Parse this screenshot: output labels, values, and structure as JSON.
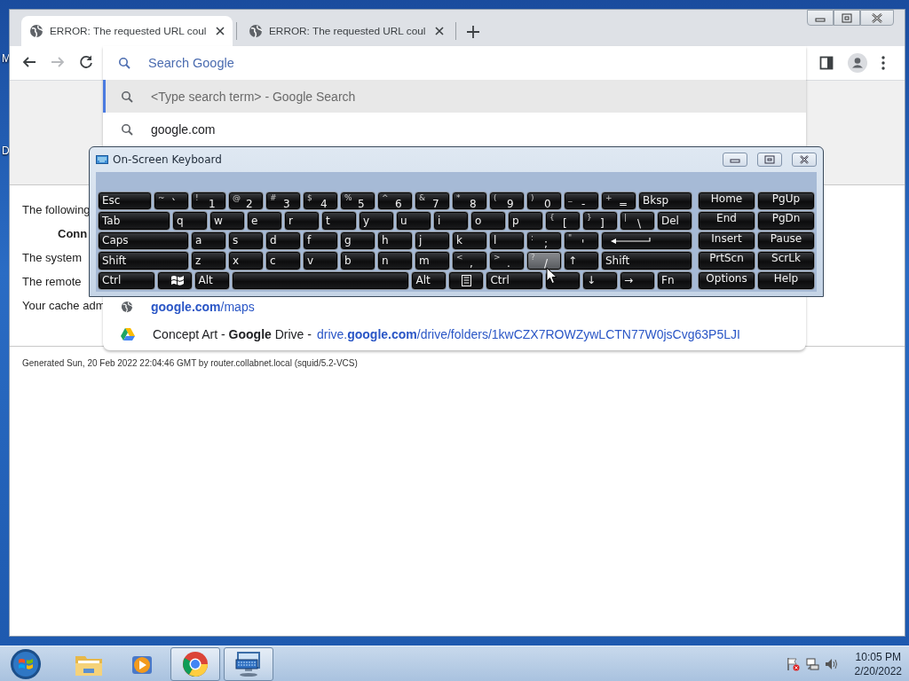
{
  "desktop": {
    "icon_labels": [
      "M",
      "D"
    ]
  },
  "browser": {
    "tabs": [
      {
        "title": "ERROR: The requested URL coul",
        "selected": true
      },
      {
        "title": "ERROR: The requested URL coul",
        "selected": false
      }
    ],
    "nav_buttons": [
      {
        "kind": "back",
        "disabled": false
      },
      {
        "kind": "forward",
        "disabled": true
      },
      {
        "kind": "reload",
        "disabled": false
      }
    ],
    "omnibox": {
      "placeholder": "Search Google",
      "suggestions": [
        {
          "kind": "search",
          "text": "<Type search term> - Google Search",
          "selected": true
        },
        {
          "kind": "search",
          "text": "google.com",
          "selected": false
        },
        {
          "kind": "history",
          "url": "**google.com**/maps",
          "selected": false
        },
        {
          "kind": "drive",
          "text": "Concept Art - **Google** Drive -",
          "url": "drive.**google.com**/drive/folders/1kwCZX7ROWZywLCTN77W0jsCvg63P5LJI",
          "selected": false
        }
      ]
    },
    "page": {
      "paragraphs": [
        {
          "kind": "plain",
          "text": "The following"
        },
        {
          "kind": "bold",
          "text": "Conn"
        },
        {
          "kind": "plain",
          "text": "The system"
        },
        {
          "kind": "plain",
          "text": "The remote"
        },
        {
          "kind": "plain",
          "text": "Your cache adm"
        }
      ],
      "footer": "Generated Sun, 20 Feb 2022 22:04:46 GMT by router.collabnet.local (squid/5.2-VCS)"
    }
  },
  "keyboard": {
    "title": "On-Screen Keyboard",
    "key_rows": [
      {
        "keys": [
          {
            "kind": "wide",
            "label": "Esc",
            "hover": false
          },
          {
            "kind": "key",
            "shift": "~",
            "label": "`",
            "hover": false
          },
          {
            "kind": "key",
            "shift": "!",
            "label": "1",
            "hover": false
          },
          {
            "kind": "key",
            "shift": "@",
            "label": "2",
            "hover": false
          },
          {
            "kind": "key",
            "shift": "#",
            "label": "3",
            "hover": false
          },
          {
            "kind": "key",
            "shift": "$",
            "label": "4",
            "hover": false
          },
          {
            "kind": "key",
            "shift": "%",
            "label": "5",
            "hover": false
          },
          {
            "kind": "key",
            "shift": "^",
            "label": "6",
            "hover": false
          },
          {
            "kind": "key",
            "shift": "&",
            "label": "7",
            "hover": false
          },
          {
            "kind": "key",
            "shift": "*",
            "label": "8",
            "hover": false
          },
          {
            "kind": "key",
            "shift": "(",
            "label": "9",
            "hover": false
          },
          {
            "kind": "key",
            "shift": ")",
            "label": "0",
            "hover": false
          },
          {
            "kind": "key",
            "shift": "_",
            "label": "-",
            "hover": false
          },
          {
            "kind": "key",
            "shift": "+",
            "label": "=",
            "hover": false
          },
          {
            "kind": "wide",
            "label": "Bksp",
            "hover": false
          }
        ]
      },
      {
        "keys": [
          {
            "kind": "wide",
            "label": "Tab",
            "hover": false
          },
          {
            "kind": "key",
            "label": "q",
            "hover": false
          },
          {
            "kind": "key",
            "label": "w",
            "hover": false
          },
          {
            "kind": "key",
            "label": "e",
            "hover": false
          },
          {
            "kind": "key",
            "label": "r",
            "hover": false
          },
          {
            "kind": "key",
            "label": "t",
            "hover": false
          },
          {
            "kind": "key",
            "label": "y",
            "hover": false
          },
          {
            "kind": "key",
            "label": "u",
            "hover": false
          },
          {
            "kind": "key",
            "label": "i",
            "hover": false
          },
          {
            "kind": "key",
            "label": "o",
            "hover": false
          },
          {
            "kind": "key",
            "label": "p",
            "hover": false
          },
          {
            "kind": "key",
            "shift": "{",
            "label": "[",
            "hover": false
          },
          {
            "kind": "key",
            "shift": "}",
            "label": "]",
            "hover": false
          },
          {
            "kind": "key",
            "shift": "|",
            "label": "\\",
            "hover": false
          },
          {
            "kind": "key",
            "label": "Del",
            "hover": false
          }
        ]
      },
      {
        "keys": [
          {
            "kind": "wide",
            "label": "Caps",
            "hover": false
          },
          {
            "kind": "key",
            "label": "a",
            "hover": false
          },
          {
            "kind": "key",
            "label": "s",
            "hover": false
          },
          {
            "kind": "key",
            "label": "d",
            "hover": false
          },
          {
            "kind": "key",
            "label": "f",
            "hover": false
          },
          {
            "kind": "key",
            "label": "g",
            "hover": false
          },
          {
            "kind": "key",
            "label": "h",
            "hover": false
          },
          {
            "kind": "key",
            "label": "j",
            "hover": false
          },
          {
            "kind": "key",
            "label": "k",
            "hover": false
          },
          {
            "kind": "key",
            "label": "l",
            "hover": false
          },
          {
            "kind": "key",
            "shift": ":",
            "label": ";",
            "hover": false
          },
          {
            "kind": "key",
            "shift": "\"",
            "label": "'",
            "hover": false
          },
          {
            "kind": "enter",
            "hover": false
          }
        ]
      },
      {
        "keys": [
          {
            "kind": "wide",
            "label": "Shift",
            "hover": false
          },
          {
            "kind": "key",
            "label": "z",
            "hover": false
          },
          {
            "kind": "key",
            "label": "x",
            "hover": false
          },
          {
            "kind": "key",
            "label": "c",
            "hover": false
          },
          {
            "kind": "key",
            "label": "v",
            "hover": false
          },
          {
            "kind": "key",
            "label": "b",
            "hover": false
          },
          {
            "kind": "key",
            "label": "n",
            "hover": false
          },
          {
            "kind": "key",
            "label": "m",
            "hover": false
          },
          {
            "kind": "key",
            "shift": "<",
            "label": ",",
            "hover": false
          },
          {
            "kind": "key",
            "shift": ">",
            "label": ".",
            "hover": false
          },
          {
            "kind": "key",
            "shift": "?",
            "label": "/",
            "hover": true
          },
          {
            "kind": "key",
            "label": "↑",
            "hover": false
          },
          {
            "kind": "wide",
            "label": "Shift",
            "hover": false
          }
        ]
      },
      {
        "keys": [
          {
            "kind": "wide",
            "label": "Ctrl",
            "hover": false
          },
          {
            "kind": "win",
            "hover": false
          },
          {
            "kind": "key",
            "label": "Alt",
            "hover": false
          },
          {
            "kind": "space",
            "hover": false
          },
          {
            "kind": "key",
            "label": "Alt",
            "hover": false
          },
          {
            "kind": "menu",
            "hover": false
          },
          {
            "kind": "wide",
            "label": "Ctrl",
            "hover": false
          },
          {
            "kind": "key",
            "hover": false
          },
          {
            "kind": "key",
            "label": "↓",
            "hover": false
          },
          {
            "kind": "key",
            "label": "→",
            "hover": false
          },
          {
            "kind": "key",
            "label": "Fn",
            "hover": false
          }
        ]
      }
    ],
    "nav_rows": [
      {
        "keys": [
          {
            "kind": "nav",
            "label": "Home",
            "hover": false
          },
          {
            "kind": "nav",
            "label": "PgUp",
            "hover": false
          }
        ]
      },
      {
        "keys": [
          {
            "kind": "nav",
            "label": "End",
            "hover": false
          },
          {
            "kind": "nav",
            "label": "PgDn",
            "hover": false
          }
        ]
      },
      {
        "keys": [
          {
            "kind": "nav",
            "label": "Insert",
            "hover": false
          },
          {
            "kind": "nav",
            "label": "Pause",
            "hover": false
          }
        ]
      },
      {
        "keys": [
          {
            "kind": "nav",
            "label": "PrtScn",
            "hover": false
          },
          {
            "kind": "nav",
            "label": "ScrLk",
            "hover": false
          }
        ]
      },
      {
        "keys": [
          {
            "kind": "nav",
            "label": "Options",
            "hover": false
          },
          {
            "kind": "nav",
            "label": "Help",
            "hover": false
          }
        ]
      }
    ]
  },
  "taskbar": {
    "items": [
      {
        "kind": "start",
        "active": false
      },
      {
        "kind": "folder",
        "active": false
      },
      {
        "kind": "media",
        "active": false
      },
      {
        "kind": "browser",
        "active": true
      },
      {
        "kind": "keyboard",
        "active": true
      }
    ],
    "clock": {
      "time": "10:05 PM",
      "date": "2/20/2022"
    }
  }
}
